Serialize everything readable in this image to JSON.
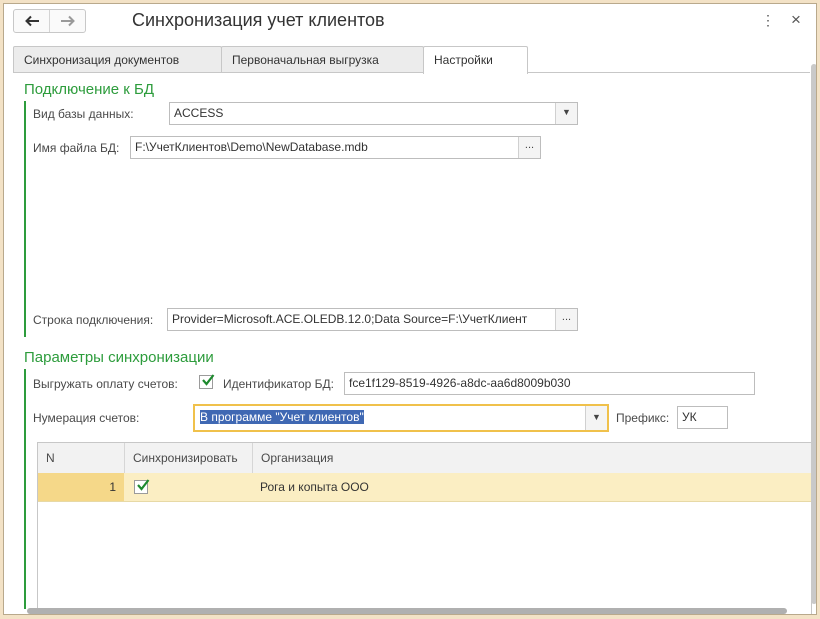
{
  "window": {
    "title": "Синхронизация учет клиентов",
    "back_icon": "arrow-left-icon",
    "forward_icon": "arrow-right-icon",
    "menu_icon": "⋮",
    "close_icon": "×"
  },
  "tabs": [
    {
      "label": "Синхронизация документов",
      "active": false
    },
    {
      "label": "Первоначальная выгрузка",
      "active": false
    },
    {
      "label": "Настройки",
      "active": true
    }
  ],
  "db_section": {
    "title": "Подключение к БД",
    "db_type_label": "Вид базы данных:",
    "db_type_value": "ACCESS",
    "file_label": "Имя файла БД:",
    "file_value": "F:\\УчетКлиентов\\Demo\\NewDatabase.mdb",
    "conn_label": "Строка подключения:",
    "conn_value": "Provider=Microsoft.ACE.OLEDB.12.0;Data Source=F:\\УчетКлиент",
    "more_button": "..."
  },
  "sync_section": {
    "title": "Параметры синхронизации",
    "export_payment_label": "Выгружать оплату счетов:",
    "export_payment_checked": true,
    "db_id_label": "Идентификатор БД:",
    "db_id_value": "fce1f129-8519-4926-a8dc-aa6d8009b030",
    "numbering_label": "Нумерация счетов:",
    "numbering_value": "В программе \"Учет клиентов\"",
    "prefix_label": "Префикс:",
    "prefix_value": "УК"
  },
  "table": {
    "columns": [
      "N",
      "Синхронизировать",
      "Организация"
    ],
    "rows": [
      {
        "n": "1",
        "sync": true,
        "org": "Рога и копыта ООО"
      }
    ]
  },
  "colors": {
    "accent_green": "#2d9c3c",
    "selected_row": "#fbeec3",
    "focus_border": "#f0c14b",
    "selection_blue": "#3f68b3"
  }
}
